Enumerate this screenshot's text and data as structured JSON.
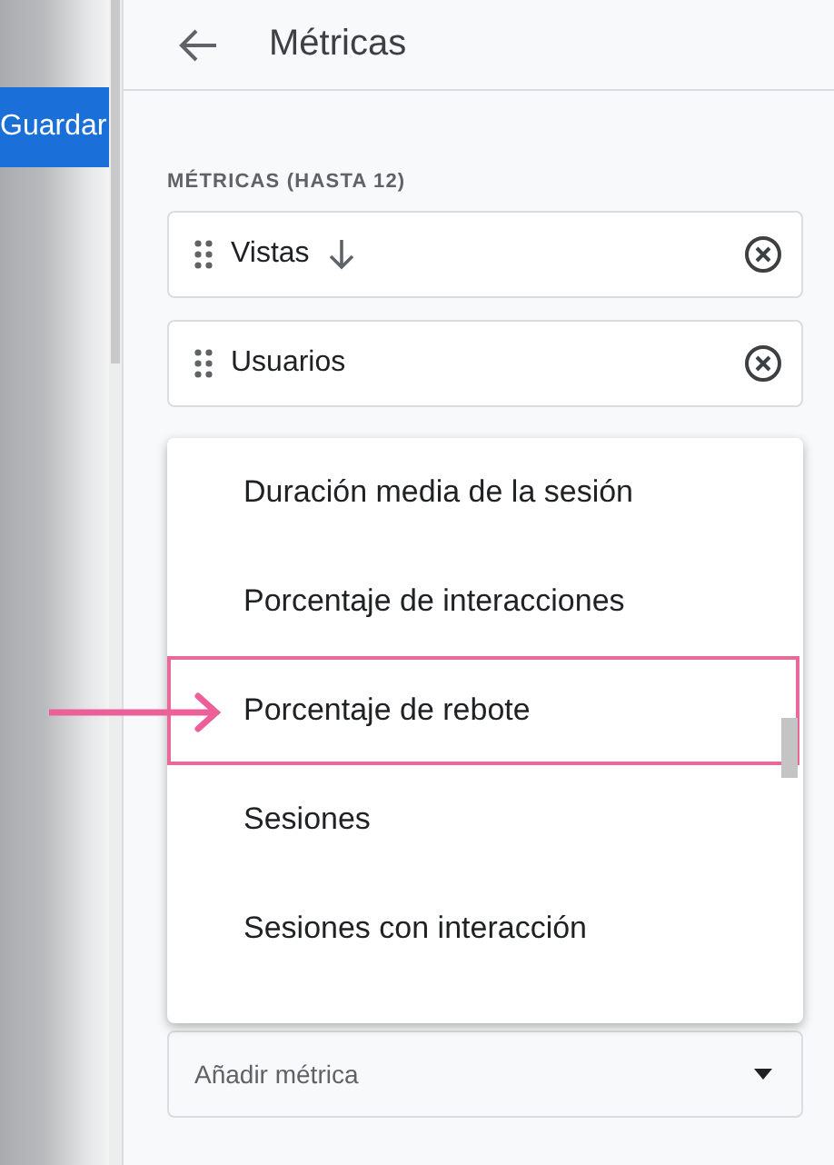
{
  "sidebar": {
    "save_button": "Guardar"
  },
  "header": {
    "title": "Métricas"
  },
  "section_label": "MÉTRICAS (HASTA 12)",
  "metrics": [
    {
      "name": "Vistas",
      "sorted": true
    },
    {
      "name": "Usuarios",
      "sorted": false
    }
  ],
  "dropdown": {
    "items": [
      {
        "label": "Duración media de la sesión",
        "highlighted": false
      },
      {
        "label": "Porcentaje de interacciones",
        "highlighted": false
      },
      {
        "label": "Porcentaje de rebote",
        "highlighted": true
      },
      {
        "label": "Sesiones",
        "highlighted": false
      },
      {
        "label": "Sesiones con interacción",
        "highlighted": false
      }
    ]
  },
  "add_field": {
    "placeholder": "Añadir métrica"
  }
}
